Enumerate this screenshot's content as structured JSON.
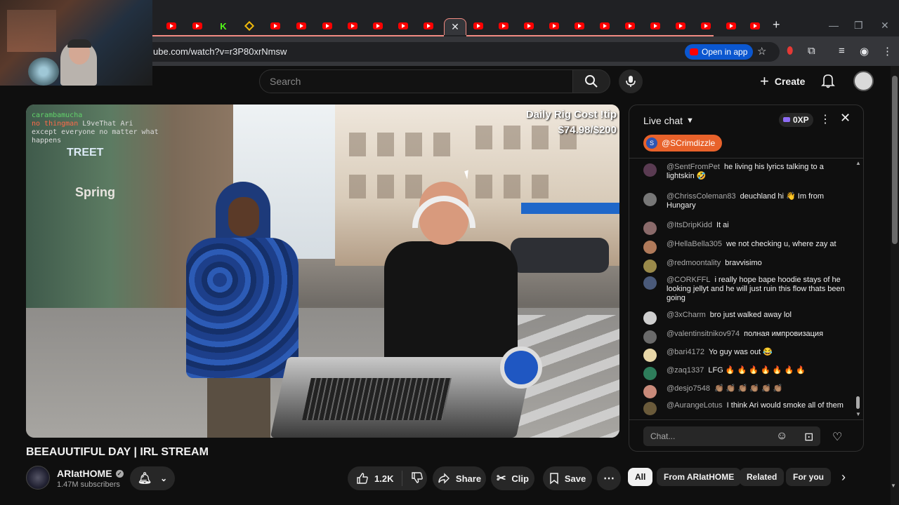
{
  "browser": {
    "url": "ube.com/watch?v=r3P80xrNmsw",
    "open_in_app": "Open in app",
    "active_tab_close": "✕",
    "new_tab": "+",
    "tab_other_label": "K"
  },
  "header": {
    "search_placeholder": "Search",
    "create_label": "Create"
  },
  "video": {
    "overlay_top_left": [
      {
        "user": "carambamucha",
        "message": ""
      },
      {
        "user": "no thingman",
        "message": "L9veThat Ari"
      },
      {
        "user": "",
        "message": "except everyone no matter what"
      },
      {
        "user": "",
        "message": "happens"
      }
    ],
    "overlay_top_right": [
      "Daily Rig Cost !tip",
      "$74.98/$200"
    ],
    "storefront_sign": "Spring",
    "street_sign": "TREET",
    "title": "BEEAUUTIFUL DAY | IRL STREAM",
    "channel_name": "ARIatHOME",
    "subscribers": "1.47M subscribers",
    "likes": "1.2K",
    "share_label": "Share",
    "clip_label": "Clip",
    "save_label": "Save"
  },
  "chips": [
    "All",
    "From ARIatHOME",
    "Related",
    "For you"
  ],
  "chat": {
    "title": "Live chat",
    "xp": "0XP",
    "pinned_user": "@SCrimdizzle",
    "pinned_initial": "S",
    "input_placeholder": "Chat...",
    "messages": [
      {
        "author": "@SentFromPet",
        "text": "he living his lyrics talking to a lightskin 🤣",
        "color": "#5a3b52"
      },
      {
        "author": "@ChrissColeman83",
        "text": "deuchland hi 👋 Im from Hungary",
        "color": "#777777"
      },
      {
        "author": "@ItsDripKidd",
        "text": "It ai",
        "color": "#8a6a6a"
      },
      {
        "author": "@HellaBella305",
        "text": "we not checking u, where zay at",
        "color": "#b07a5a"
      },
      {
        "author": "@redmoontality",
        "text": "bravvisimo",
        "color": "#9a8a4a"
      },
      {
        "author": "@CORKFFL",
        "text": "i really hope bape hoodie stays of he looking jellyt and he will just ruin this flow thats been going",
        "color": "#4a5a7a"
      },
      {
        "author": "@3xCharm",
        "text": "bro just walked away lol",
        "color": "#cfcfcf"
      },
      {
        "author": "@valentinsitnikov974",
        "text": "полная импровизация",
        "color": "#6a6a6a"
      },
      {
        "author": "@bari4172",
        "text": "Yo guy was out 😂",
        "color": "#e8d7a8"
      },
      {
        "author": "@zaq1337",
        "text": "LFG 🔥 🔥 🔥 🔥 🔥 🔥 🔥",
        "color": "#2e7d5b"
      },
      {
        "author": "@desjo7548",
        "text": "👏🏽 👏🏽 👏🏽 👏🏽 👏🏽 👏🏽",
        "color": "#c98a7a"
      },
      {
        "author": "@AurangeLotus",
        "text": "I think Ari would smoke all of them",
        "color": "#6a5a3a"
      }
    ]
  }
}
